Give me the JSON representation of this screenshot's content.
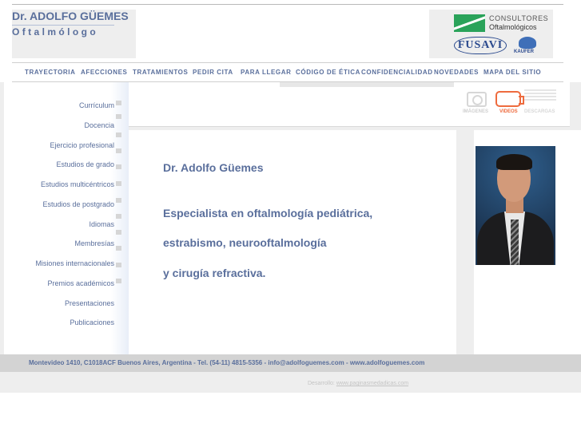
{
  "header": {
    "logo_name": "Dr. ADOLFO GÜEMES",
    "logo_subtitle": "Oftalmólogo",
    "partners": {
      "consultores_line1": "CONSULTORES",
      "consultores_line2": "Oftalmológicos",
      "fusavi": "FUSAVI",
      "kaufer": "KAUFER"
    }
  },
  "nav": {
    "items": [
      {
        "label": "TRAYECTORIA"
      },
      {
        "label": "AFECCIONES"
      },
      {
        "label": "TRATAMIENTOS"
      },
      {
        "label": "PEDIR CITA"
      },
      {
        "label": "PARA LLEGAR"
      },
      {
        "label": "CÓDIGO DE ÉTICA"
      },
      {
        "label": "CONFIDENCIALIDAD"
      },
      {
        "label": "NOVEDADES"
      },
      {
        "label": "MAPA DEL SITIO"
      }
    ]
  },
  "sidebar": {
    "items": [
      {
        "label": "Currículum"
      },
      {
        "label": "Docencia"
      },
      {
        "label": "Ejercicio profesional"
      },
      {
        "label": "Estudios de grado"
      },
      {
        "label": "Estudios multicéntricos"
      },
      {
        "label": "Estudios de postgrado"
      },
      {
        "label": "Idiomas"
      },
      {
        "label": "Membresías"
      },
      {
        "label": "Misiones internacionales"
      },
      {
        "label": "Premios académicos"
      },
      {
        "label": "Presentaciones"
      },
      {
        "label": "Publicaciones"
      }
    ]
  },
  "media": {
    "images_label": "IMÁGENES",
    "videos_label": "VIDEOS",
    "downloads_label": "DESCARGAS",
    "icons": [
      "camera-icon",
      "video-camera-icon",
      "document-icon"
    ],
    "active_color": "#ee6b3e",
    "inactive_color": "#d7d7d7"
  },
  "main": {
    "name": "Dr. Adolfo Güemes",
    "line1": "Especialista en oftalmología pediátrica,",
    "line2": "estrabismo, neurooftalmología",
    "line3": "y cirugía refractiva."
  },
  "footer": {
    "contact": "Montevideo 1410, C1018ACF Buenos Aires, Argentina - Tel. (54-11) 4815-5356 - info@adolfoguemes.com - www.adolfoguemes.com",
    "credit_prefix": "Desarrollo:",
    "credit_link": "www.paginasmedadicas.com"
  },
  "colors": {
    "brand_blue": "#5a6f9c",
    "panel_gray": "#eeeeee"
  }
}
